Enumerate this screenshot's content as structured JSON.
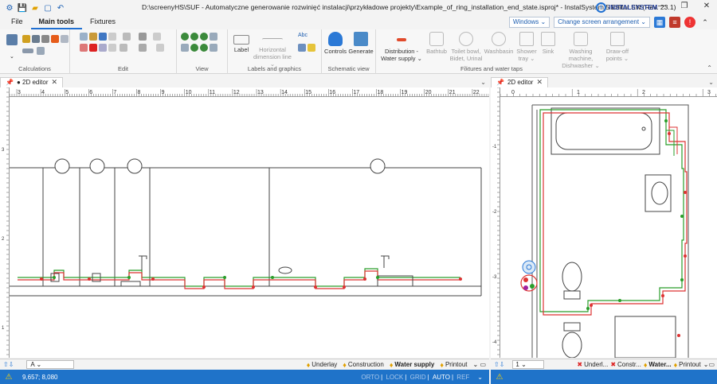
{
  "titlebar": {
    "title": "D:\\screenyHS\\SUF - Automatyczne generowanie rozwinięć instalacji\\przykładowe projekty\\Example_of_ring_installation_end_state.isproj* - InstalSystem 5 Editor EN (Rev. 23.1)",
    "brand": "INSTALSYSTEM",
    "minimize": "—",
    "restore": "❐",
    "close": "✕"
  },
  "menu": {
    "tabs": [
      "File",
      "Main tools",
      "Fixtures"
    ],
    "windows_label": "Windows ⌄",
    "arrange_label": "Change screen arrangement ⌄"
  },
  "ribbon": {
    "groups": {
      "calculations": "Calculations",
      "edit": "Edit",
      "view": "View",
      "labels": "Labels and graphics",
      "schematic": "Schematic view",
      "fixtures": "Fixtures and water taps"
    },
    "buttons": {
      "label": "Label",
      "hdim": "Horizontal\ndimension line ⌄",
      "controls": "Controls",
      "generate": "Generate",
      "distribution": "Distribution -\nWater supply ⌄",
      "bathtub": "Bathtub",
      "toilet": "Toilet bowl,\nBidet, Urinal ⌄",
      "washbasin": "Washbasin",
      "shower": "Shower\ntray ⌄",
      "sink": "Sink",
      "washing": "Washing machine,\nDishwasher ⌄",
      "drawoff": "Draw-off\npoints ⌄"
    }
  },
  "left_editor": {
    "tab_label": "● 2D editor",
    "ruler_numbers": [
      "3",
      "4",
      "5",
      "6",
      "7",
      "8",
      "9",
      "10",
      "11",
      "12",
      "13",
      "14",
      "15",
      "16",
      "17",
      "18",
      "19",
      "20",
      "21",
      "22"
    ],
    "ruler_corner": "74",
    "layer_select": "A",
    "layers": [
      "Underlay",
      "Construction",
      "Water supply",
      "Printout"
    ],
    "vertical_labels": [
      "3",
      "2",
      "1"
    ]
  },
  "right_editor": {
    "tab_label": "2D editor",
    "ruler_numbers": [
      "0",
      "1",
      "2",
      "3"
    ],
    "ruler_corner": "37",
    "layer_select": "1",
    "layers": [
      "Underl...",
      "Constr...",
      "Water...",
      "Printout"
    ],
    "vertical_labels": [
      "-1",
      "-2",
      "-3",
      "-4"
    ]
  },
  "statusbar": {
    "coords": "9,657; 8,080",
    "modes": [
      "ORTO",
      "LOCK",
      "GRID",
      "AUTO",
      "REF"
    ]
  }
}
